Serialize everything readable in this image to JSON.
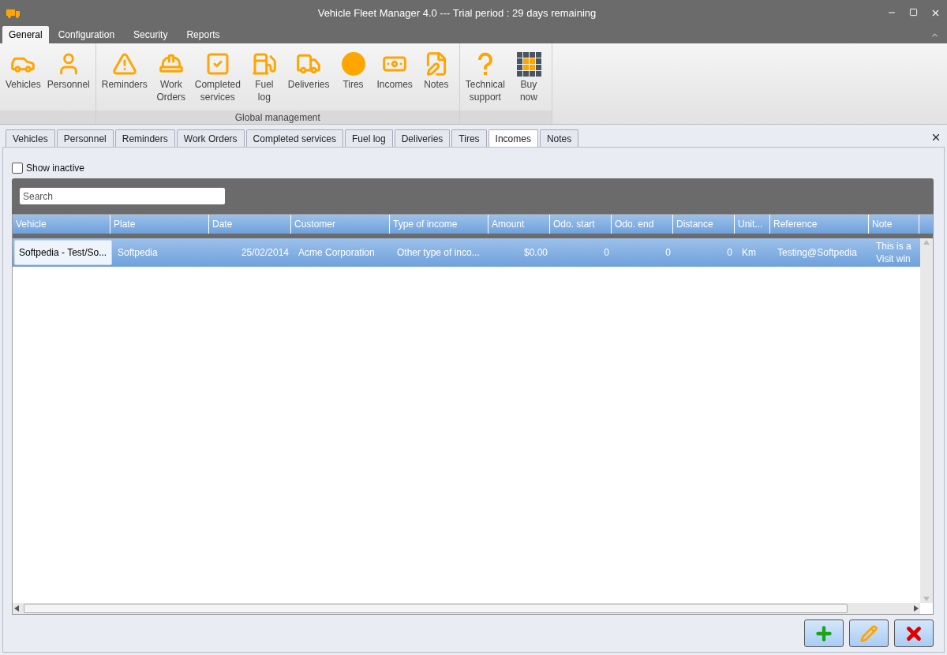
{
  "window": {
    "title": "Vehicle Fleet Manager 4.0 --- Trial period : 29 days remaining"
  },
  "menu_tabs": [
    {
      "label": "General",
      "selected": true
    },
    {
      "label": "Configuration",
      "selected": false
    },
    {
      "label": "Security",
      "selected": false
    },
    {
      "label": "Reports",
      "selected": false
    }
  ],
  "ribbon_groups": [
    {
      "items": [
        [
          "Vehicles"
        ],
        [
          "Personnel"
        ]
      ]
    },
    {
      "label": "Global management",
      "items": [
        [
          "Reminders"
        ],
        [
          "Work",
          "Orders"
        ],
        [
          "Completed",
          "services"
        ],
        [
          "Fuel",
          "log"
        ],
        [
          "Deliveries"
        ],
        [
          "Tires"
        ],
        [
          "Incomes"
        ],
        [
          "Notes"
        ]
      ]
    },
    {
      "items": [
        [
          "Technical",
          "support"
        ],
        [
          "Buy",
          "now"
        ]
      ]
    }
  ],
  "doc_tabs": [
    {
      "label": "Vehicles",
      "selected": false
    },
    {
      "label": "Personnel",
      "selected": false
    },
    {
      "label": "Reminders",
      "selected": false
    },
    {
      "label": "Work Orders",
      "selected": false
    },
    {
      "label": "Completed services",
      "selected": false
    },
    {
      "label": "Fuel log",
      "selected": false
    },
    {
      "label": "Deliveries",
      "selected": false
    },
    {
      "label": "Tires",
      "selected": false
    },
    {
      "label": "Incomes",
      "selected": true
    },
    {
      "label": "Notes",
      "selected": false
    }
  ],
  "show_inactive": {
    "label": "Show inactive",
    "checked": false
  },
  "search": {
    "placeholder": "Search"
  },
  "table": {
    "columns": [
      "Vehicle",
      "Plate",
      "Date",
      "Customer",
      "Type of income",
      "Amount",
      "Odo. start",
      "Odo. end",
      "Distance",
      "Unit...",
      "Reference",
      "Note"
    ],
    "rows": [
      {
        "selected": true,
        "cells": [
          [
            "Softpedia - Test/So..."
          ],
          [
            "Softpedia"
          ],
          [
            "25/02/2014"
          ],
          [
            "Acme Corporation"
          ],
          [
            "Other type of inco..."
          ],
          [
            "$0.00"
          ],
          [
            "0"
          ],
          [
            "0"
          ],
          [
            "0"
          ],
          [
            "Km"
          ],
          [
            "Testing@Softpedia"
          ],
          [
            "This is a",
            "Visit win"
          ]
        ]
      }
    ]
  }
}
